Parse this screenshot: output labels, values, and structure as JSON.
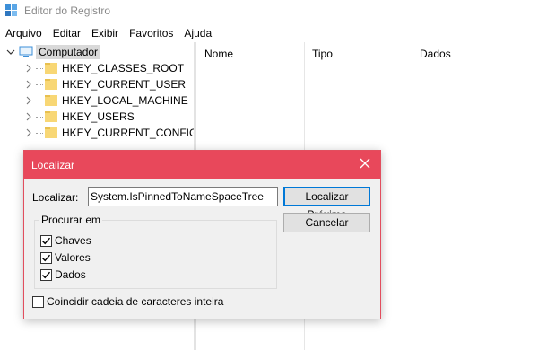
{
  "window": {
    "title": "Editor do Registro"
  },
  "menu": [
    "Arquivo",
    "Editar",
    "Exibir",
    "Favoritos",
    "Ajuda"
  ],
  "tree": {
    "root": "Computador",
    "hives": [
      "HKEY_CLASSES_ROOT",
      "HKEY_CURRENT_USER",
      "HKEY_LOCAL_MACHINE",
      "HKEY_USERS",
      "HKEY_CURRENT_CONFIG"
    ]
  },
  "list": {
    "columns": [
      "Nome",
      "Tipo",
      "Dados"
    ]
  },
  "dialog": {
    "title": "Localizar",
    "find_label": "Localizar:",
    "find_value": "System.IsPinnedToNameSpaceTree",
    "find_next_label": "Localizar Próxima",
    "cancel_label": "Cancelar",
    "search_group_label": "Procurar em",
    "options": [
      {
        "label": "Chaves",
        "checked": true
      },
      {
        "label": "Valores",
        "checked": true
      },
      {
        "label": "Dados",
        "checked": true
      }
    ],
    "match_whole_label": "Coincidir cadeia de caracteres inteira",
    "match_whole_checked": false
  },
  "colors": {
    "dialog_title_bar": "#e8485b",
    "folder": "#f8d775",
    "focus_blue": "#0078d7"
  }
}
